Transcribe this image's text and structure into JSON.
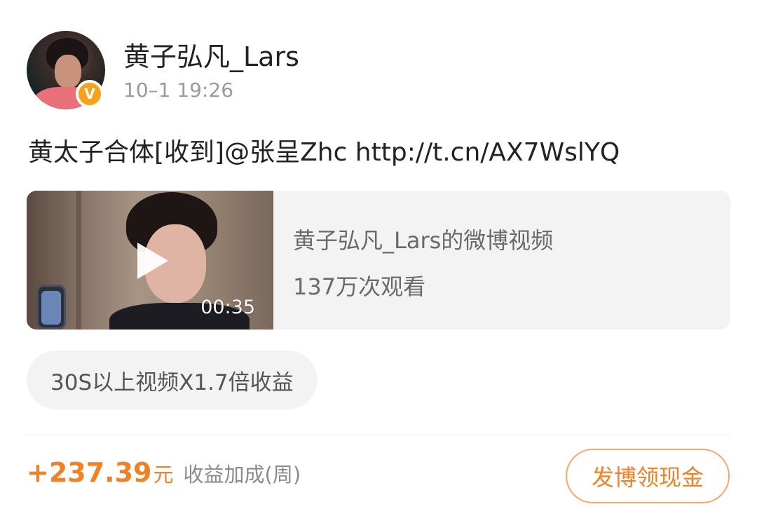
{
  "author": {
    "name": "黄子弘凡_Lars",
    "timestamp": "10–1 19:26",
    "verified_badge": "V"
  },
  "post": {
    "text": "黄太子合体[收到]@张呈Zhc http://t.cn/AX7WslYQ"
  },
  "video": {
    "title": "黄子弘凡_Lars的微博视频",
    "views": "137万次观看",
    "duration": "00:35"
  },
  "promo": {
    "label": "30S以上视频X1.7倍收益"
  },
  "earnings": {
    "amount": "+237.39",
    "unit": "元",
    "label": "收益加成(周)"
  },
  "cta": {
    "label": "发博领现金"
  },
  "colors": {
    "accent": "#f08128",
    "badge": "#f3a21b",
    "muted_text": "#9b9b9b",
    "card_bg": "#f3f3f3"
  }
}
